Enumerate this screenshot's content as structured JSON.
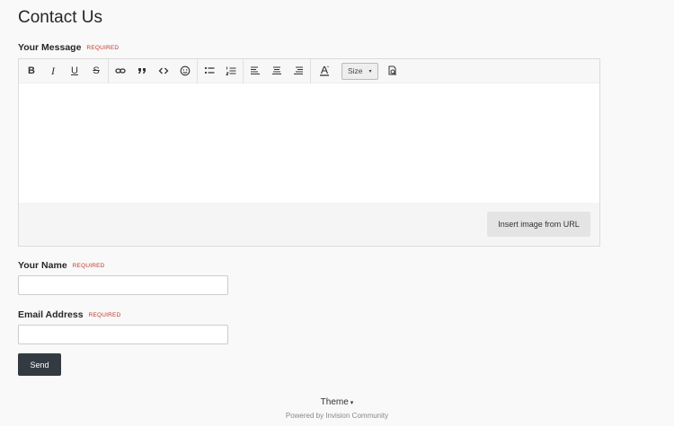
{
  "page": {
    "title": "Contact Us"
  },
  "message_field": {
    "label": "Your Message",
    "required": "REQUIRED",
    "toolbar": {
      "bold": "B",
      "italic": "I",
      "underline": "U",
      "strike": "S",
      "size_label": "Size",
      "size_caret": "▾"
    },
    "insert_image_label": "Insert image from URL"
  },
  "name_field": {
    "label": "Your Name",
    "required": "REQUIRED",
    "value": ""
  },
  "email_field": {
    "label": "Email Address",
    "required": "REQUIRED",
    "value": ""
  },
  "send_label": "Send",
  "footer": {
    "theme_label": "Theme",
    "theme_caret": "▾",
    "powered_by": "Powered by Invision Community"
  }
}
